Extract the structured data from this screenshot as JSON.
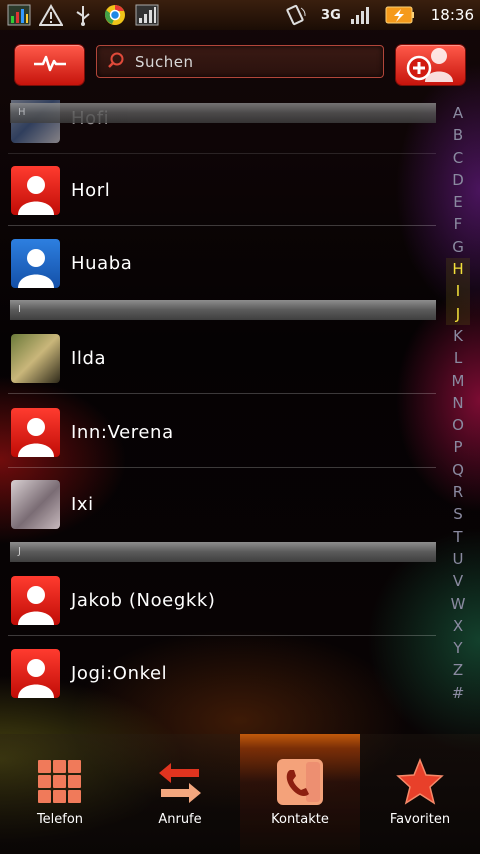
{
  "status_bar": {
    "icons": [
      "app-grid-icon",
      "warning-icon",
      "usb-icon",
      "chrome-beta-icon",
      "signal-chart-icon"
    ],
    "right_icons": [
      "rotation-icon",
      "signal-bars-icon",
      "battery-charging-icon"
    ],
    "network": "3G",
    "time": "18:36"
  },
  "toolbar": {
    "activity_button_icon": "heartbeat-icon",
    "search_placeholder": "Suchen",
    "add_contact_icon": "add-contact-icon"
  },
  "contacts": [
    {
      "name": "Hofi",
      "avatar": "photo"
    },
    {
      "name": "Horl",
      "avatar": "default-red"
    },
    {
      "name": "Huaba",
      "avatar": "default-blue"
    },
    {
      "name": "Ilda",
      "avatar": "photo"
    },
    {
      "name": "Inn:Verena",
      "avatar": "default-red"
    },
    {
      "name": "Ixi",
      "avatar": "photo"
    },
    {
      "name": "Jakob (Noegkk)",
      "avatar": "default-red"
    },
    {
      "name": "Jogi:Onkel",
      "avatar": "default-red"
    }
  ],
  "sections": {
    "h": "H",
    "i": "I",
    "j": "J"
  },
  "alphabet": [
    "A",
    "B",
    "C",
    "D",
    "E",
    "F",
    "G",
    "H",
    "I",
    "J",
    "K",
    "L",
    "M",
    "N",
    "O",
    "P",
    "Q",
    "R",
    "S",
    "T",
    "U",
    "V",
    "W",
    "X",
    "Y",
    "Z",
    "#"
  ],
  "alphabet_active": [
    "H",
    "I",
    "J"
  ],
  "nav": [
    {
      "label": "Telefon",
      "icon": "dialpad-icon"
    },
    {
      "label": "Anrufe",
      "icon": "call-log-icon"
    },
    {
      "label": "Kontakte",
      "icon": "contacts-icon",
      "selected": true
    },
    {
      "label": "Favoriten",
      "icon": "star-icon"
    }
  ]
}
